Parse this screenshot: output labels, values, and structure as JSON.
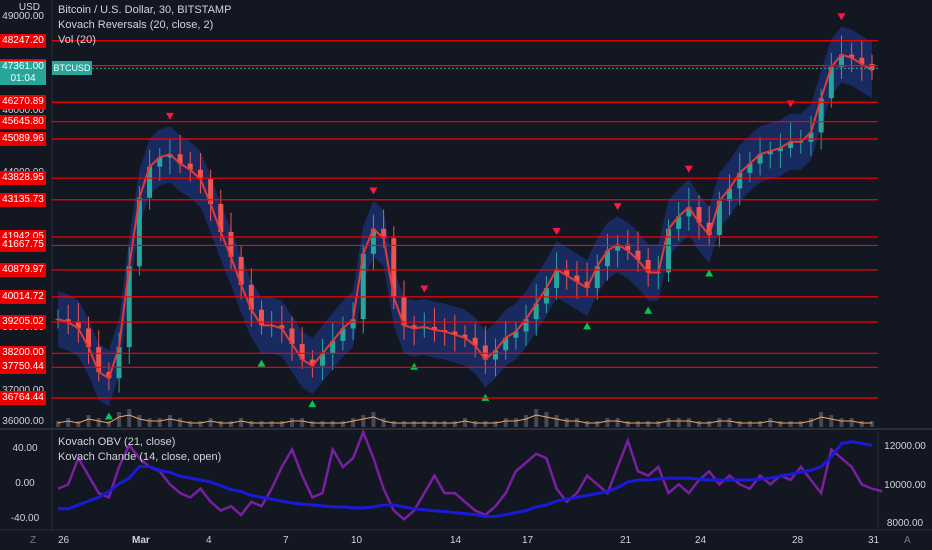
{
  "legend": {
    "main_title": "Bitcoin / U.S. Dollar, 30, BITSTAMP",
    "indicator_1": "Kovach Reversals (20, close, 2)",
    "indicator_2": "Vol (20)",
    "osc_indicator_1": "Kovach OBV (21, close)",
    "osc_indicator_2": "Kovach Chande (14, close, open)"
  },
  "price_axis": {
    "currency": "USD",
    "ticks": [
      "49000.00",
      "46000.00",
      "44000.00",
      "39000.00",
      "37000.00",
      "36000.00"
    ],
    "tick_values": [
      49000,
      46000,
      44000,
      39000,
      37000,
      36000
    ]
  },
  "levels": [
    48247.2,
    47446.62,
    46270.89,
    45645.8,
    45089.96,
    43828.95,
    43135.73,
    41942.05,
    41667.75,
    40879.97,
    40014.72,
    39205.02,
    38200.0,
    37750.44,
    36764.44
  ],
  "level_labels": [
    "48247.20",
    "47446.62",
    "46270.89",
    "45645.80",
    "45089.96",
    "43828.95",
    "43135.73",
    "41942.05",
    "41667.75",
    "40879.97",
    "40014.72",
    "39205.02",
    "38200.00",
    "37750.44",
    "36764.44"
  ],
  "current_price": {
    "value": "47361.00",
    "countdown": "01:04",
    "ticker": "BTCUSD"
  },
  "osc_axis_left": {
    "ticks": [
      "40.00",
      "0.00",
      "-40.00"
    ]
  },
  "osc_axis_right": {
    "ticks": [
      "12000.00",
      "10000.00",
      "8000.00"
    ]
  },
  "time_axis": {
    "labels": [
      "26",
      "Mar",
      "4",
      "7",
      "10",
      "14",
      "17",
      "21",
      "24",
      "28",
      "31"
    ]
  },
  "corner": {
    "bottom_left": "Z",
    "bottom_right": "A"
  },
  "colors": {
    "background": "#131722",
    "level_line": "#ff0000",
    "candle_up": "#26a69a",
    "candle_down": "#ef5350",
    "band": "#1f3a93",
    "signal_line": "#e53935",
    "obv": "#1a1adb",
    "chande": "#7b1fa2",
    "tag_current": "#26a69a"
  },
  "chart_data": {
    "type": "line",
    "x": [
      0,
      2,
      4,
      6,
      8,
      10,
      12,
      14,
      16,
      18,
      20,
      22,
      24,
      26,
      28,
      30,
      32,
      34,
      36,
      38,
      40,
      42,
      44,
      46,
      48,
      50,
      52,
      54,
      56,
      58,
      60,
      62,
      64,
      66,
      68,
      70,
      72,
      74,
      76,
      78,
      80,
      82,
      84,
      86,
      88,
      90,
      92,
      94,
      96,
      98,
      100,
      102,
      104,
      106,
      108,
      110,
      112,
      114,
      116,
      118,
      120,
      122,
      124,
      126,
      128,
      130,
      132,
      134,
      136,
      138,
      140,
      142,
      144,
      146,
      148,
      150,
      152,
      154,
      156,
      158,
      160
    ],
    "series": [
      {
        "name": "price",
        "values": [
          39300,
          39200,
          39000,
          38400,
          37600,
          37400,
          38400,
          41000,
          43200,
          44200,
          44500,
          44600,
          44300,
          44100,
          43800,
          43000,
          42100,
          41300,
          40400,
          39600,
          39100,
          39100,
          39000,
          38500,
          38000,
          37800,
          38200,
          38600,
          39000,
          39300,
          41400,
          42200,
          41900,
          40000,
          39100,
          39000,
          39050,
          38950,
          38900,
          38800,
          38700,
          38450,
          38000,
          38300,
          38700,
          38900,
          39300,
          39800,
          40300,
          40900,
          40700,
          40500,
          40300,
          41000,
          41500,
          41700,
          41500,
          41200,
          40800,
          40800,
          42200,
          42600,
          42900,
          42400,
          42000,
          43100,
          43500,
          44000,
          44300,
          44600,
          44700,
          44800,
          45000,
          45000,
          45300,
          46400,
          47400,
          47800,
          47700,
          47500,
          47300
        ]
      }
    ],
    "volume": [
      2,
      3,
      2,
      4,
      3,
      2,
      5,
      6,
      4,
      3,
      3,
      4,
      3,
      2,
      2,
      3,
      2,
      2,
      3,
      2,
      2,
      2,
      2,
      3,
      3,
      2,
      2,
      2,
      2,
      3,
      4,
      5,
      3,
      2,
      2,
      2,
      2,
      2,
      2,
      2,
      3,
      2,
      2,
      2,
      3,
      3,
      4,
      6,
      5,
      4,
      3,
      3,
      2,
      2,
      3,
      3,
      2,
      2,
      2,
      2,
      3,
      3,
      3,
      2,
      2,
      3,
      3,
      2,
      2,
      2,
      3,
      2,
      2,
      2,
      3,
      5,
      4,
      3,
      3,
      2,
      2
    ],
    "obv": [
      8800,
      8800,
      9000,
      9200,
      9400,
      9700,
      10100,
      10400,
      11000,
      11000,
      10800,
      10700,
      10500,
      10400,
      10300,
      10200,
      10000,
      9800,
      9700,
      9500,
      9400,
      9300,
      9200,
      9100,
      9050,
      9000,
      8950,
      8900,
      8900,
      8850,
      8850,
      8900,
      9000,
      9000,
      8900,
      8800,
      8750,
      8700,
      8650,
      8600,
      8550,
      8500,
      8400,
      8400,
      8500,
      8600,
      8700,
      8900,
      9000,
      9200,
      9300,
      9400,
      9500,
      9600,
      9700,
      9900,
      10200,
      10300,
      10300,
      10350,
      10400,
      10400,
      10400,
      10350,
      10300,
      10300,
      10300,
      10300,
      10300,
      10350,
      10400,
      10500,
      10600,
      10700,
      10800,
      11000,
      11500,
      12200,
      12300,
      12200,
      12100
    ],
    "chande": [
      -5,
      0,
      30,
      10,
      -10,
      -15,
      20,
      45,
      30,
      20,
      15,
      0,
      -10,
      -15,
      -5,
      -20,
      -30,
      -25,
      -35,
      -20,
      -25,
      -5,
      20,
      40,
      10,
      -15,
      -10,
      40,
      20,
      30,
      60,
      30,
      -5,
      -30,
      -40,
      -30,
      -10,
      10,
      -10,
      -10,
      -20,
      -30,
      -35,
      -25,
      -10,
      15,
      25,
      35,
      30,
      -5,
      -20,
      -10,
      10,
      0,
      -10,
      20,
      50,
      15,
      10,
      20,
      -10,
      0,
      -10,
      5,
      15,
      0,
      10,
      0,
      -5,
      10,
      0,
      10,
      5,
      20,
      5,
      -10,
      40,
      30,
      20,
      0,
      -5,
      -8
    ],
    "ylim_price": [
      35800,
      49300
    ],
    "ylim_chande": [
      -50,
      60
    ],
    "ylim_obv": [
      7800,
      12800
    ]
  }
}
